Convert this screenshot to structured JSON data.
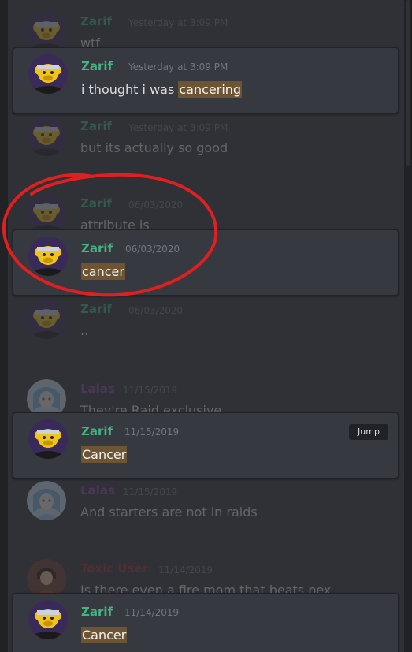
{
  "colors": {
    "zarif": "#43b581",
    "lalas": "#8e44ad",
    "toxic": "#992d22",
    "highlight": "#6d5533",
    "annotation": "#e02020"
  },
  "messages": [
    {
      "role": "context",
      "author": "Zarif",
      "timestamp": "Yesterday at 3:09 PM",
      "content": "wtf",
      "avatar": "monkey-avatar"
    },
    {
      "role": "result",
      "author": "Zarif",
      "timestamp": "Yesterday at 3:09 PM",
      "content_before": "i thought i was ",
      "content_highlight": "cancering",
      "content_after": "",
      "avatar": "monkey-avatar"
    },
    {
      "role": "context",
      "author": "Zarif",
      "timestamp": "Yesterday at 3:09 PM",
      "content": "but its actually so good",
      "avatar": "monkey-avatar"
    },
    {
      "role": "context",
      "author": "Zarif",
      "timestamp": "06/03/2020",
      "content": "attribute is",
      "avatar": "monkey-avatar"
    },
    {
      "role": "result",
      "author": "Zarif",
      "timestamp": "06/03/2020",
      "content_before": "",
      "content_highlight": "cancer",
      "content_after": "",
      "avatar": "monkey-avatar"
    },
    {
      "role": "context",
      "author": "Zarif",
      "timestamp": "06/03/2020",
      "content": "..",
      "avatar": "monkey-avatar"
    },
    {
      "role": "context",
      "author": "Lalas",
      "timestamp": "11/15/2019",
      "content": "They're Raid exclusive",
      "avatar": "anime-avatar"
    },
    {
      "role": "result",
      "author": "Zarif",
      "timestamp": "11/15/2019",
      "content_before": "",
      "content_highlight": "Cancer",
      "content_after": "",
      "avatar": "monkey-avatar",
      "jump_label": "Jump"
    },
    {
      "role": "context",
      "author": "Lalas",
      "timestamp": "11/15/2019",
      "content": "And starters are not in raids",
      "avatar": "anime-avatar"
    },
    {
      "role": "context",
      "author": "Toxic User",
      "timestamp": "11/14/2019",
      "content": "Is there even a fire mom that beats pex",
      "avatar": "red-character-avatar"
    },
    {
      "role": "result",
      "author": "Zarif",
      "timestamp": "11/14/2019",
      "content_before": "",
      "content_highlight": "Cancer",
      "content_after": "",
      "avatar": "monkey-avatar"
    }
  ]
}
